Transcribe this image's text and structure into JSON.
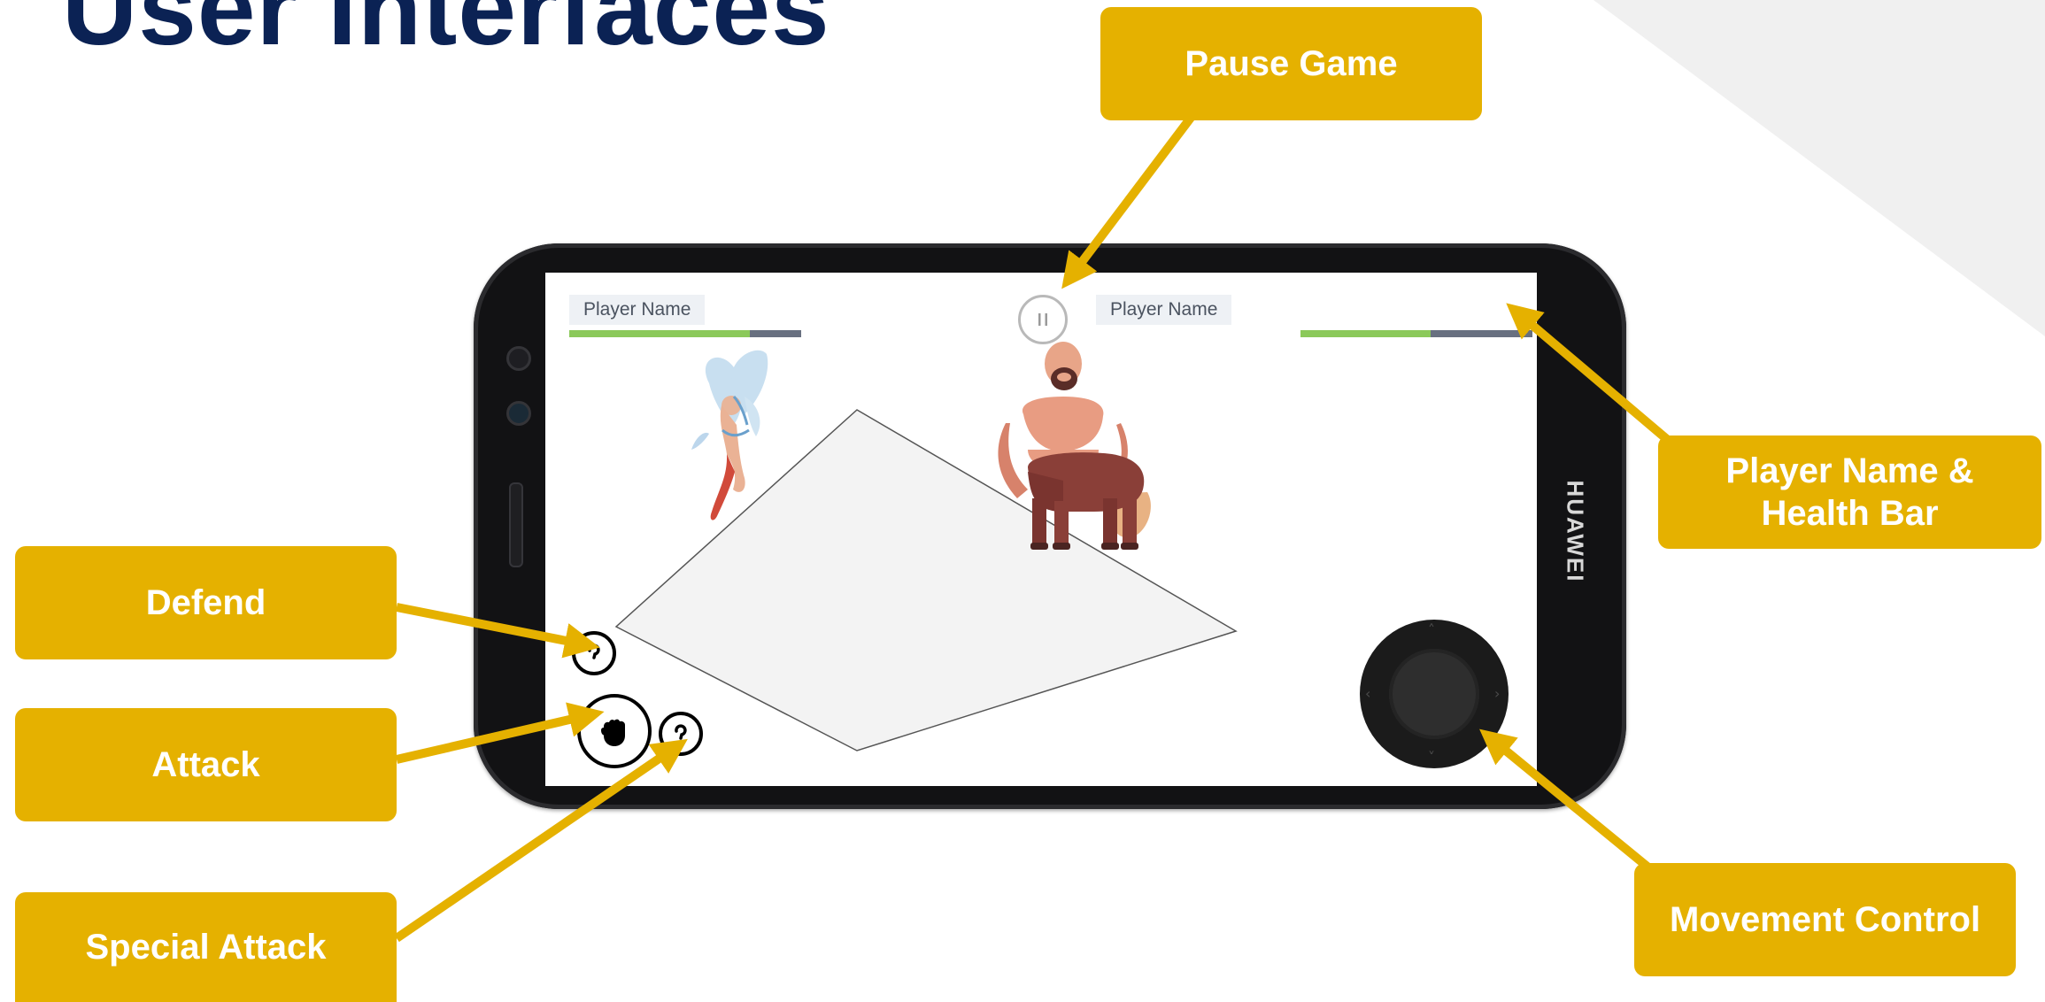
{
  "slide": {
    "title": "User Interfaces"
  },
  "colors": {
    "accent": "#e5b100",
    "title": "#0b2254",
    "health_green": "#8bc95a",
    "health_gray": "#687080"
  },
  "phone": {
    "brand": "HUAWEI"
  },
  "game": {
    "left_player": {
      "name": "Player Name",
      "health": 0.78
    },
    "right_player": {
      "name": "Player Name",
      "health": 0.56
    },
    "pause_icon": "pause-icon",
    "attack_icon": "fist-icon",
    "defend_icon": "cooldown-icon",
    "special_icon": "cooldown-icon"
  },
  "callouts": {
    "pause": "Pause Game",
    "player_health": "Player Name & Health Bar",
    "defend": "Defend",
    "attack": "Attack",
    "special_attack": "Special Attack",
    "movement": "Movement Control"
  }
}
